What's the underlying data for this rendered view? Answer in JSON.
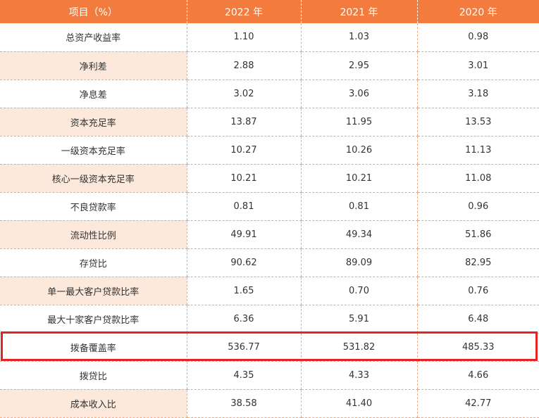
{
  "table": {
    "headers": [
      "项目（%）",
      "2022 年",
      "2021 年",
      "2020 年"
    ],
    "rows": [
      {
        "label": "总资产收益率",
        "values": [
          "1.10",
          "1.03",
          "0.98"
        ]
      },
      {
        "label": "净利差",
        "values": [
          "2.88",
          "2.95",
          "3.01"
        ]
      },
      {
        "label": "净息差",
        "values": [
          "3.02",
          "3.06",
          "3.18"
        ]
      },
      {
        "label": "资本充足率",
        "values": [
          "13.87",
          "11.95",
          "13.53"
        ]
      },
      {
        "label": "一级资本充足率",
        "values": [
          "10.27",
          "10.26",
          "11.13"
        ]
      },
      {
        "label": "核心一级资本充足率",
        "values": [
          "10.21",
          "10.21",
          "11.08"
        ]
      },
      {
        "label": "不良贷款率",
        "values": [
          "0.81",
          "0.81",
          "0.96"
        ]
      },
      {
        "label": "流动性比例",
        "values": [
          "49.91",
          "49.34",
          "51.86"
        ]
      },
      {
        "label": "存贷比",
        "values": [
          "90.62",
          "89.09",
          "82.95"
        ]
      },
      {
        "label": "单一最大客户贷款比率",
        "values": [
          "1.65",
          "0.70",
          "0.76"
        ]
      },
      {
        "label": "最大十家客户贷款比率",
        "values": [
          "6.36",
          "5.91",
          "6.48"
        ]
      },
      {
        "label": "拨备覆盖率",
        "values": [
          "536.77",
          "531.82",
          "485.33"
        ]
      },
      {
        "label": "拨贷比",
        "values": [
          "4.35",
          "4.33",
          "4.66"
        ]
      },
      {
        "label": "成本收入比",
        "values": [
          "38.58",
          "41.40",
          "42.77"
        ]
      }
    ]
  },
  "colors": {
    "header_bg": "#f47b3e",
    "row_shade": "#fce9dc",
    "highlight_border": "#e32424"
  }
}
